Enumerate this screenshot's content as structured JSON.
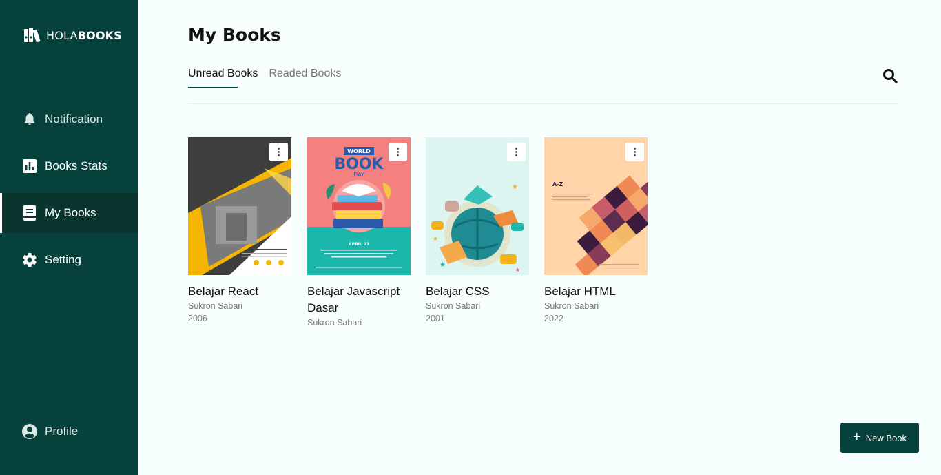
{
  "brand": {
    "light": "HOLA",
    "bold": "BOOKS"
  },
  "sidebar": {
    "items": [
      {
        "label": "Notification",
        "icon": "bell-icon"
      },
      {
        "label": "Books Stats",
        "icon": "chart-icon"
      },
      {
        "label": "My Books",
        "icon": "book-icon",
        "active": true
      },
      {
        "label": "Setting",
        "icon": "gear-icon"
      }
    ],
    "profile": {
      "label": "Profile",
      "icon": "user-circle-icon"
    }
  },
  "main": {
    "title": "My Books",
    "tabs": [
      {
        "label": "Unread Books",
        "active": true
      },
      {
        "label": "Readed Books",
        "active": false
      }
    ]
  },
  "books": [
    {
      "title": "Belajar React",
      "author": "Sukron Sabari",
      "year": "2006"
    },
    {
      "title": "Belajar Javascript Dasar",
      "author": "Sukron Sabari",
      "year": ""
    },
    {
      "title": "Belajar CSS",
      "author": "Sukron Sabari",
      "year": "2001"
    },
    {
      "title": "Belajar HTML",
      "author": "Sukron Sabari",
      "year": "2022"
    }
  ],
  "covers": {
    "world_book_day": {
      "line1": "WORLD",
      "line2": "BOOK",
      "line3": "DAY",
      "date": "APRIL 23"
    },
    "az": {
      "label": "A-Z"
    }
  },
  "new_book_button": {
    "label": "New Book"
  },
  "colors": {
    "sidebar": "#07413b",
    "accent": "#07413b",
    "background": "#f7fffe"
  }
}
